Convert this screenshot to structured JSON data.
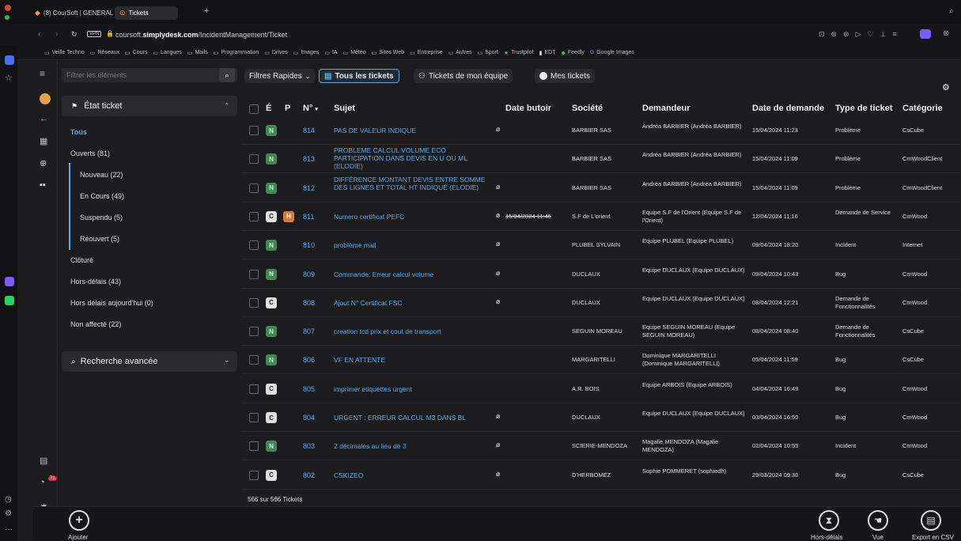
{
  "browser": {
    "tabs": [
      {
        "label": "(8) CourSoft | GENERAL"
      },
      {
        "label": "Tickets"
      }
    ],
    "url_prefix": "coursoft.",
    "url_bold": "simplydesk.com",
    "url_suffix": "/IncidentManagement/Ticket",
    "bookmarks": [
      "Veille Techno",
      "Réseaux",
      "Cours",
      "Langues",
      "Mails",
      "Programmation",
      "Drives",
      "Images",
      "IA",
      "Météo",
      "Sites Web",
      "Entreprise",
      "Autres",
      "Sport",
      "Trustpilot",
      "EDT",
      "Feedly",
      "Google Images"
    ]
  },
  "sidebar": {
    "search_placeholder": "Filtrer les éléments",
    "etat_header": "État ticket",
    "filters": [
      {
        "label": "Tous"
      },
      {
        "label": "Ouverts (81)"
      },
      {
        "label": "Nouveau (22)"
      },
      {
        "label": "En Cours (49)"
      },
      {
        "label": "Suspendu (5)"
      },
      {
        "label": "Réouvert (5)"
      },
      {
        "label": "Clôturé"
      },
      {
        "label": "Hors-délais (43)"
      },
      {
        "label": "Hors délais aujourd'hui (0)"
      },
      {
        "label": "Non affecté (22)"
      }
    ],
    "advanced_search": "Recherche avancée"
  },
  "toolbar": {
    "quick_filters": "Filtres Rapides",
    "all_tickets": "Tous les tickets",
    "team_tickets": "Tickets de mon équipe",
    "my_tickets": "Mes tickets"
  },
  "table": {
    "headers": {
      "e": "É",
      "p": "P",
      "num": "N°",
      "subject": "Sujet",
      "due": "Date butoir",
      "company": "Société",
      "requester": "Demandeur",
      "request_date": "Date de demande",
      "type": "Type de ticket",
      "category": "Catégorie"
    },
    "rows": [
      {
        "e": "N",
        "p": "",
        "num": "814",
        "subject": "PAS DE VALEUR INDIQUE",
        "attach": true,
        "due": "",
        "company": "BARBIER SAS",
        "requester": "Andréa BARBIER (Andréa BARBIER)",
        "date": "15/04/2024 11:23",
        "type": "Problème",
        "category": "CsCube"
      },
      {
        "e": "N",
        "p": "",
        "num": "813",
        "subject": "PROBLEME CALCUL VOLUME ECO PARTICIPATION DANS DEVIS EN U OU ML (ELODIE)",
        "attach": false,
        "due": "",
        "company": "BARBIER SAS",
        "requester": "Andréa BARBIER (Andréa BARBIER)",
        "date": "15/04/2024 11:09",
        "type": "Problème",
        "category": "CmWoodClient"
      },
      {
        "e": "N",
        "p": "",
        "num": "812",
        "subject": "DIFFÉRENCE MONTANT DEVIS ENTRE SOMME DES LIGNES ET TOTAL HT INDIQUÉ (ELODIE)",
        "attach": true,
        "due": "",
        "company": "BARBIER SAS",
        "requester": "Andréa BARBIER (Andréa BARBIER)",
        "date": "15/04/2024 11:09",
        "type": "Problème",
        "category": "CmWoodClient"
      },
      {
        "e": "C",
        "p": "H",
        "num": "811",
        "subject": "Numero certificat PEFC",
        "attach": true,
        "due": "15/04/2024 11:46",
        "company": "S.F de L'orient",
        "requester": "Equipe S.F de l'Orient (Equipe S.F de l'Orient)",
        "date": "12/04/2024 11:16",
        "type": "Demande de Service",
        "category": "CmWood"
      },
      {
        "e": "N",
        "p": "",
        "num": "810",
        "subject": "problème mail",
        "attach": true,
        "due": "",
        "company": "PLUBEL SYLVAIN",
        "requester": "Equipe PLUBEL (Equipe PLUBEL)",
        "date": "09/04/2024 18:20",
        "type": "Incident",
        "category": "Internet"
      },
      {
        "e": "N",
        "p": "",
        "num": "809",
        "subject": "Commande: Erreur calcul volume",
        "attach": true,
        "due": "",
        "company": "DUCLAUX",
        "requester": "Equipe DUCLAUX (Equipe DUCLAUX)",
        "date": "09/04/2024 10:43",
        "type": "Bug",
        "category": "CmWood"
      },
      {
        "e": "C",
        "p": "",
        "num": "808",
        "subject": "Ajout N° Certificat FSC",
        "attach": true,
        "due": "",
        "company": "DUCLAUX",
        "requester": "Equipe DUCLAUX (Equipe DUCLAUX)",
        "date": "08/04/2024 12:21",
        "type": "Demande de Fonctionnalités",
        "category": "CmWood"
      },
      {
        "e": "N",
        "p": "",
        "num": "807",
        "subject": "creation tcd prix et cout de transport",
        "attach": false,
        "due": "",
        "company": "SEGUIN MOREAU",
        "requester": "Equipe SEGUIN MOREAU (Equipe SEGUIN MOREAU)",
        "date": "08/04/2024 08:40",
        "type": "Demande de Fonctionnalités",
        "category": "CsCube"
      },
      {
        "e": "N",
        "p": "",
        "num": "806",
        "subject": "VF EN ATTENTE",
        "attach": false,
        "due": "",
        "company": "MARGARITELLI",
        "requester": "Dominique MARGARITELLI (Dominique MARGARITELLI)",
        "date": "05/04/2024 11:59",
        "type": "Bug",
        "category": "CsCube"
      },
      {
        "e": "C",
        "p": "",
        "num": "805",
        "subject": "imprimer etiquettes urgent",
        "attach": false,
        "due": "",
        "company": "A.R. BOIS",
        "requester": "Equipe ARBOIS (Equipe ARBOIS)",
        "date": "04/04/2024 16:49",
        "type": "Bug",
        "category": "CmWood"
      },
      {
        "e": "C",
        "p": "",
        "num": "804",
        "subject": "URGENT : ERREUR CALCUL M3 DANS BL",
        "attach": true,
        "due": "",
        "company": "DUCLAUX",
        "requester": "Equipe DUCLAUX (Equipe DUCLAUX)",
        "date": "03/04/2024 16:50",
        "type": "Bug",
        "category": "CmWood"
      },
      {
        "e": "N",
        "p": "",
        "num": "803",
        "subject": "2 décimales au lieu de 3",
        "attach": true,
        "due": "",
        "company": "SCIERIE-MENDOZA",
        "requester": "Magalie MENDOZA (Magalie MENDOZA)",
        "date": "02/04/2024 10:55",
        "type": "Incident",
        "category": "CmWood"
      },
      {
        "e": "C",
        "p": "",
        "num": "802",
        "subject": "CSKIZEO",
        "attach": true,
        "due": "",
        "company": "D'HERBOMEZ",
        "requester": "Sophie POMMERET (sophiedh)",
        "date": "29/03/2024 09:30",
        "type": "Bug",
        "category": "CsCube"
      }
    ],
    "footer_count": "566 sur 566 Tickets"
  },
  "bottom": {
    "add": "Ajouter",
    "overdue": "Hors-délais",
    "view": "Vue",
    "export": "Export en CSV"
  },
  "badges": {
    "notif_count": "71"
  },
  "colors": {
    "accent": "#5aa9e6",
    "badge_new": "#3e8a52",
    "badge_closed": "#e0e0e0",
    "badge_high": "#d67a3e"
  }
}
